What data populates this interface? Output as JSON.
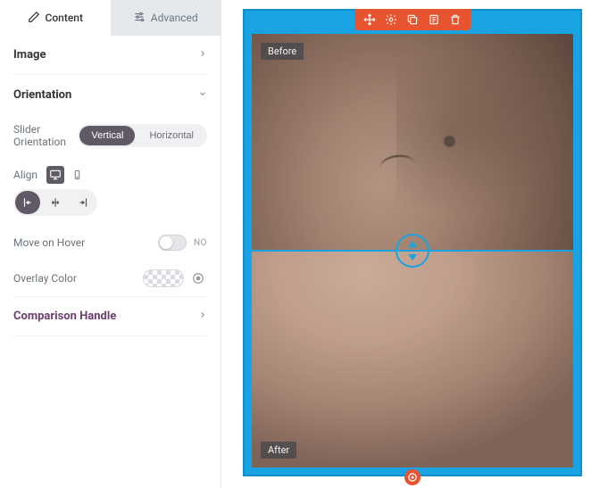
{
  "tabs": {
    "content": "Content",
    "advanced": "Advanced"
  },
  "sections": {
    "image": "Image",
    "orientation": "Orientation",
    "comparison_handle": "Comparison Handle"
  },
  "orientation": {
    "slider_label": "Slider Orientation",
    "vertical": "Vertical",
    "horizontal": "Horizontal",
    "align_label": "Align",
    "hover_label": "Move on Hover",
    "hover_state": "NO",
    "overlay_label": "Overlay Color"
  },
  "preview": {
    "before_label": "Before",
    "after_label": "After"
  }
}
